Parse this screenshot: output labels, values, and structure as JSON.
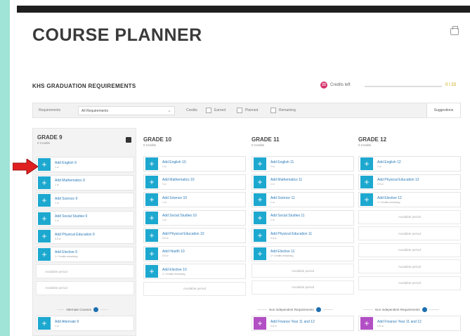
{
  "header": {
    "title": "COURSE PLANNER"
  },
  "requirements": {
    "title": "KHS GRADUATION REQUIREMENTS",
    "credits_left_value": "23",
    "credits_left_label": "Credits left",
    "credits_progress": "0 / 23",
    "credits_fraction": 0.0
  },
  "filters": {
    "requirements_label": "Requirements",
    "requirements_value": "All Requirements",
    "credits_label": "Credits",
    "earned_label": "Earned",
    "planned_label": "Planned",
    "remaining_label": "Remaining",
    "suggestions_label": "Suggestions"
  },
  "grades": [
    {
      "title": "GRADE 9",
      "credits": "0 Credits",
      "courses": [
        {
          "name": "Add English 9",
          "sub": "1 cr"
        },
        {
          "name": "Add Mathematics 9",
          "sub": "1 cr"
        },
        {
          "name": "Add Science 9",
          "sub": "1 cr"
        },
        {
          "name": "Add Social Studies 9",
          "sub": "1 cr"
        },
        {
          "name": "Add Physical Education 9",
          "sub": "0.5 cr"
        },
        {
          "name": "Add Elective 9",
          "sub": "1+ Credits remaining"
        }
      ],
      "available": [
        "Available period",
        "Available period"
      ],
      "section_label": "Alternate Courses",
      "extra": [
        {
          "name": "Add Alternate 9",
          "sub": "1 cr"
        }
      ]
    },
    {
      "title": "GRADE 10",
      "credits": "0 Credits",
      "courses": [
        {
          "name": "Add English 10",
          "sub": "1 cr"
        },
        {
          "name": "Add Mathematics 10",
          "sub": "1 cr"
        },
        {
          "name": "Add Science 10",
          "sub": "1 cr"
        },
        {
          "name": "Add Social Studies 10",
          "sub": "1 cr"
        },
        {
          "name": "Add Physical Education 10",
          "sub": "0.5 cr"
        },
        {
          "name": "Add Health 10",
          "sub": "0.5 cr"
        },
        {
          "name": "Add Elective 10",
          "sub": "1+ Credits remaining"
        }
      ],
      "available": [
        "Available period"
      ]
    },
    {
      "title": "GRADE 11",
      "credits": "0 Credits",
      "courses": [
        {
          "name": "Add English 11",
          "sub": "1 cr"
        },
        {
          "name": "Add Mathematics 11",
          "sub": "1 cr"
        },
        {
          "name": "Add Science 11",
          "sub": "1 cr"
        },
        {
          "name": "Add Social Studies 11",
          "sub": "1 cr"
        },
        {
          "name": "Add Physical Education 11",
          "sub": "0.5 cr"
        },
        {
          "name": "Add Elective 11",
          "sub": "1+ Credits remaining"
        }
      ],
      "available": [
        "Available period",
        "Available period"
      ],
      "section_label": "Non Independent Requirements",
      "extra": [
        {
          "name": "Add Finance Year 11 and 12",
          "sub": "0.5 cr"
        }
      ]
    },
    {
      "title": "GRADE 12",
      "credits": "0 Credits",
      "courses": [
        {
          "name": "Add English 12",
          "sub": "1 cr"
        },
        {
          "name": "Add Physical Education 12",
          "sub": "0.5 cr"
        },
        {
          "name": "Add Elective 12",
          "sub": "1+ Credits remaining"
        }
      ],
      "available": [
        "Available period",
        "Available period",
        "Available period",
        "Available period",
        "Available period"
      ],
      "section_label": "Non Independent Requirements",
      "extra": [
        {
          "name": "Add Finance Year 11 and 12",
          "sub": "0.5 cr"
        }
      ]
    }
  ]
}
